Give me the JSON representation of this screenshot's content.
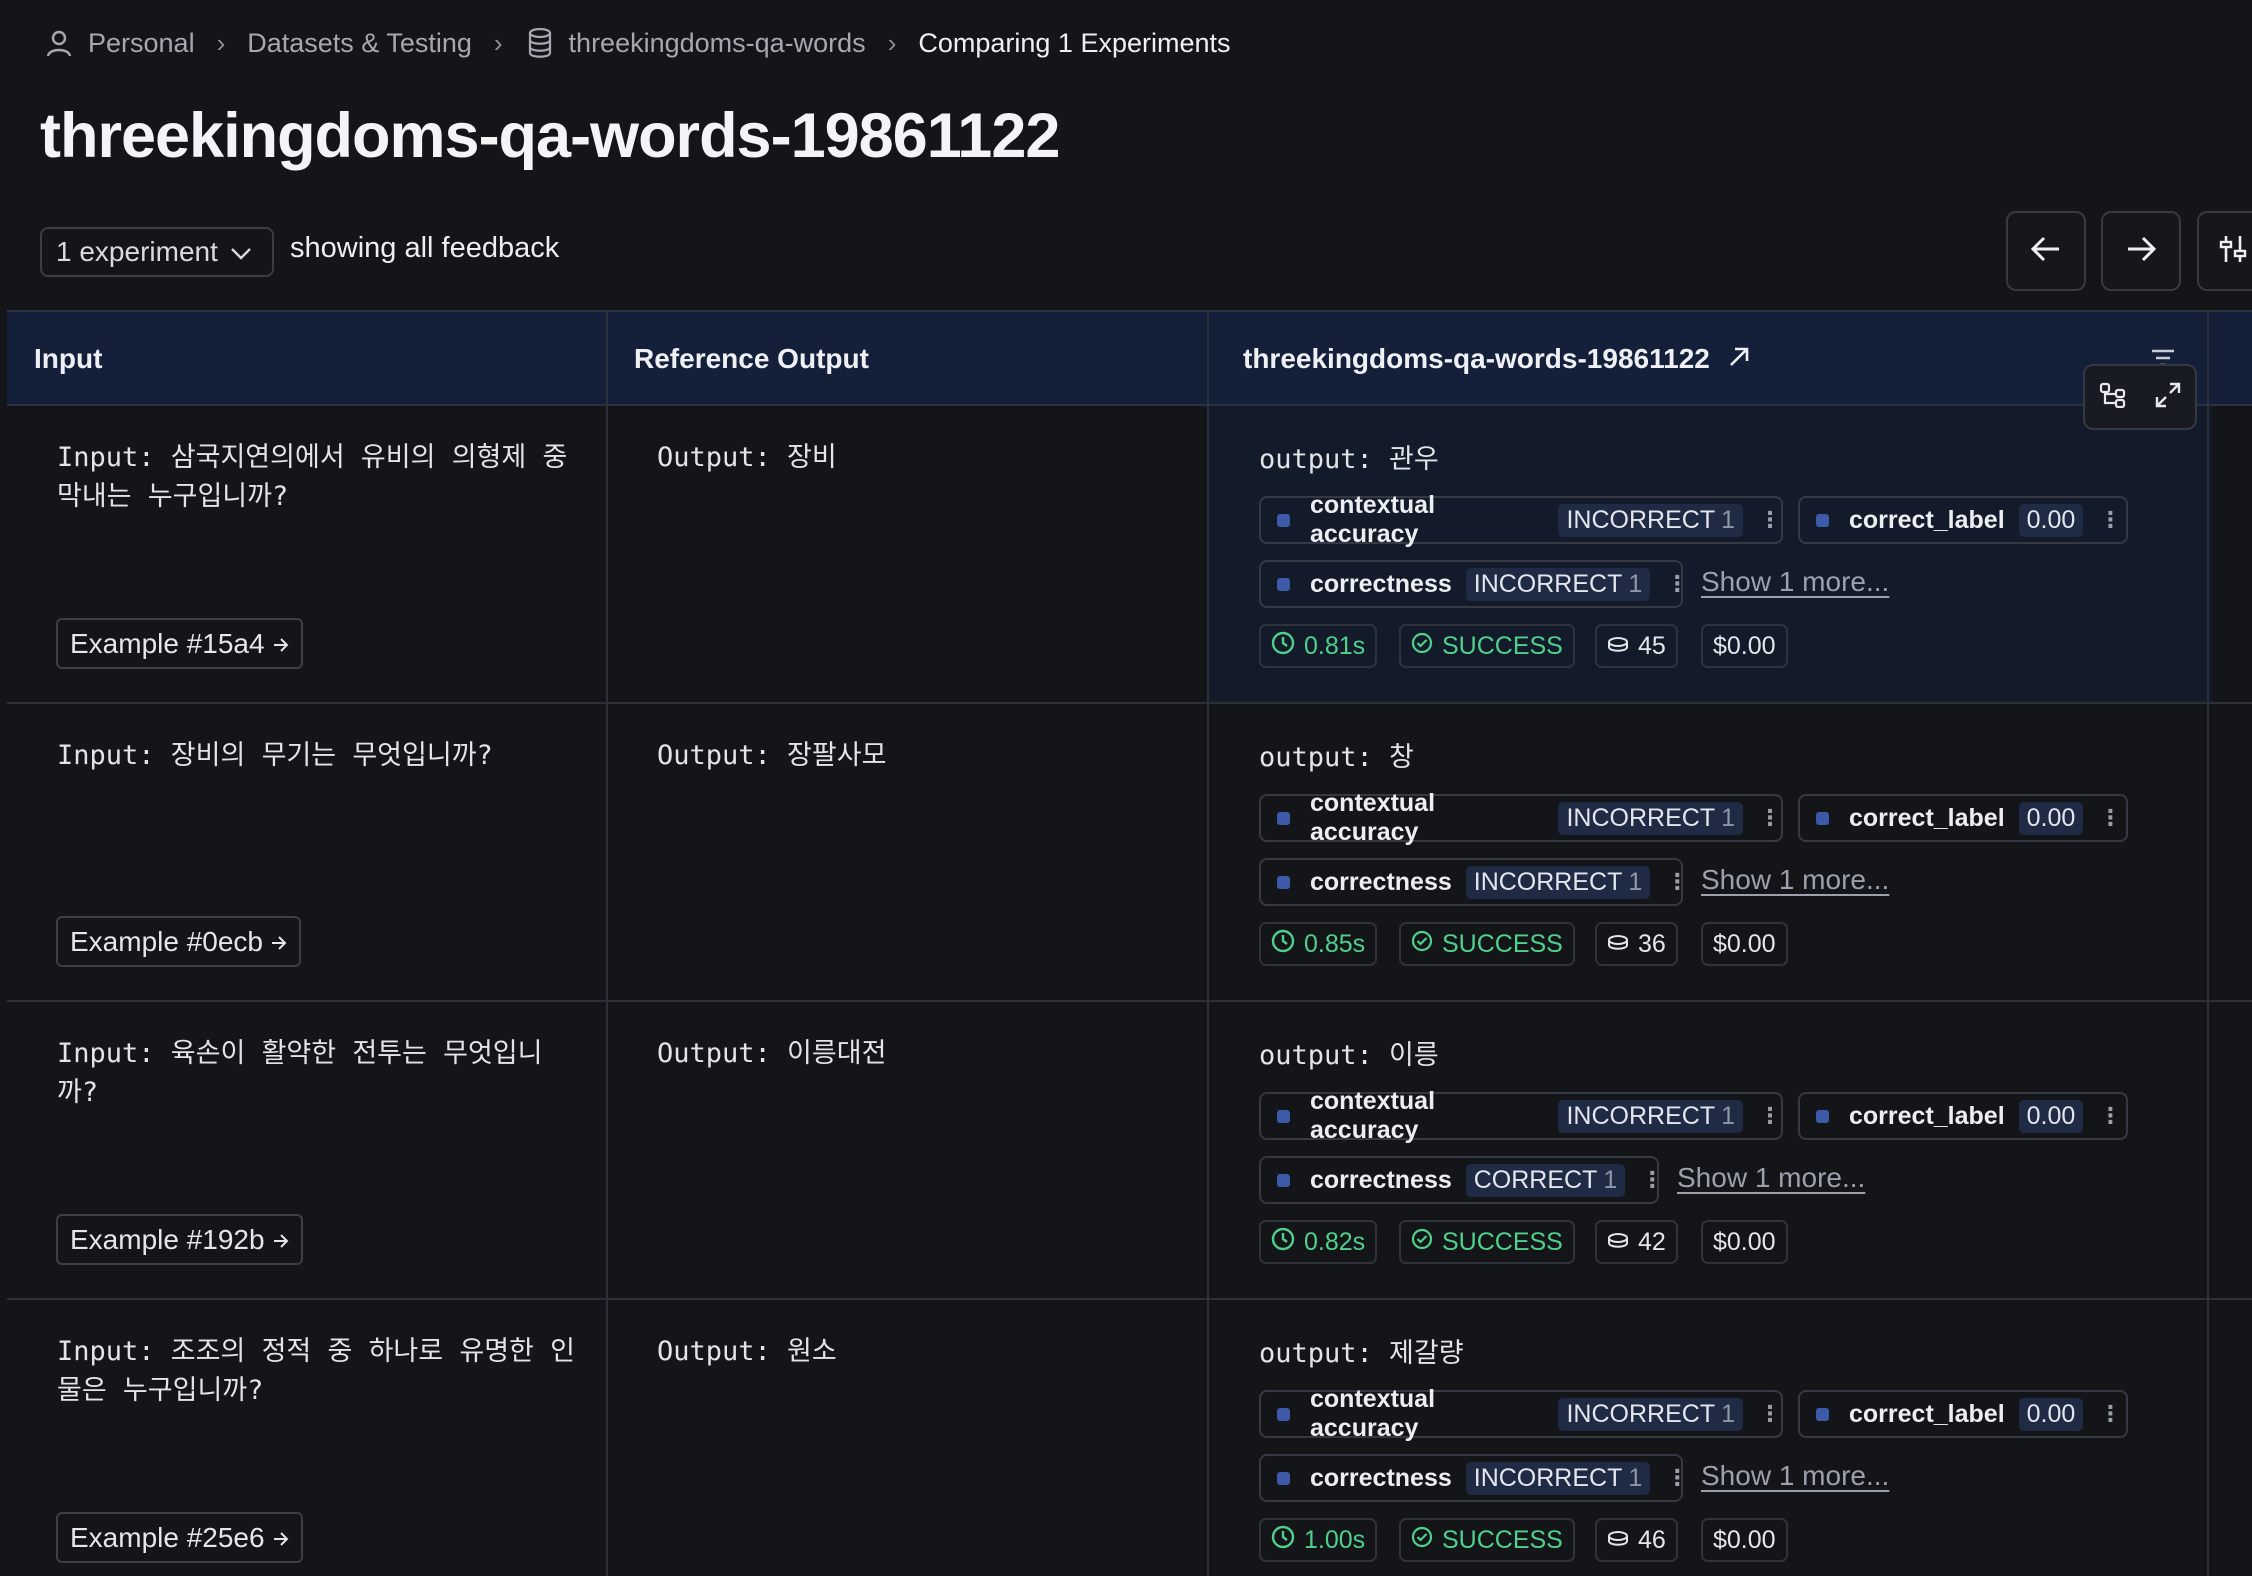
{
  "breadcrumb": {
    "personal": "Personal",
    "datasets": "Datasets & Testing",
    "dataset": "threekingdoms-qa-words",
    "current": "Comparing 1 Experiments"
  },
  "title": "threekingdoms-qa-words-19861122",
  "toolbar": {
    "experiment_select": "1 experiment",
    "feedback_label": "showing all feedback"
  },
  "table": {
    "headers": {
      "input": "Input",
      "reference": "Reference Output",
      "experiment": "threekingdoms-qa-words-19861122"
    },
    "rows": [
      {
        "input": "Input: 삼국지연의에서 유비의 의형제 중 막내는 누구입니까?",
        "reference": "Output: 장비",
        "output": "output: 관우",
        "example": "Example #15a4",
        "feedback": {
          "contextual_key": "contextual accuracy",
          "contextual_val": "INCORRECT",
          "contextual_n": "1",
          "label_key": "correct_label",
          "label_val": "0.00",
          "correctness_key": "correctness",
          "correctness_val": "INCORRECT",
          "correctness_n": "1",
          "show_more": "Show 1 more..."
        },
        "stats": {
          "latency": "0.81s",
          "status": "SUCCESS",
          "tokens": "45",
          "cost": "$0.00"
        }
      },
      {
        "input": "Input: 장비의 무기는 무엇입니까?",
        "reference": "Output: 장팔사모",
        "output": "output: 창",
        "example": "Example #0ecb",
        "feedback": {
          "contextual_key": "contextual accuracy",
          "contextual_val": "INCORRECT",
          "contextual_n": "1",
          "label_key": "correct_label",
          "label_val": "0.00",
          "correctness_key": "correctness",
          "correctness_val": "INCORRECT",
          "correctness_n": "1",
          "show_more": "Show 1 more..."
        },
        "stats": {
          "latency": "0.85s",
          "status": "SUCCESS",
          "tokens": "36",
          "cost": "$0.00"
        }
      },
      {
        "input": "Input: 육손이 활약한 전투는 무엇입니까?",
        "reference": "Output: 이릉대전",
        "output": "output: 이릉",
        "example": "Example #192b",
        "feedback": {
          "contextual_key": "contextual accuracy",
          "contextual_val": "INCORRECT",
          "contextual_n": "1",
          "label_key": "correct_label",
          "label_val": "0.00",
          "correctness_key": "correctness",
          "correctness_val": "CORRECT",
          "correctness_n": "1",
          "show_more": "Show 1 more..."
        },
        "stats": {
          "latency": "0.82s",
          "status": "SUCCESS",
          "tokens": "42",
          "cost": "$0.00"
        }
      },
      {
        "input": "Input: 조조의 정적 중 하나로 유명한 인물은 누구입니까?",
        "reference": "Output: 원소",
        "output": "output: 제갈량",
        "example": "Example #25e6",
        "feedback": {
          "contextual_key": "contextual accuracy",
          "contextual_val": "INCORRECT",
          "contextual_n": "1",
          "label_key": "correct_label",
          "label_val": "0.00",
          "correctness_key": "correctness",
          "correctness_val": "INCORRECT",
          "correctness_n": "1",
          "show_more": "Show 1 more..."
        },
        "stats": {
          "latency": "1.00s",
          "status": "SUCCESS",
          "tokens": "46",
          "cost": "$0.00"
        }
      }
    ]
  },
  "colors": {
    "background": "#141519",
    "header_bg": "#14203a",
    "success": "#4fd18b",
    "feedback_square": "#3d5aa8"
  }
}
